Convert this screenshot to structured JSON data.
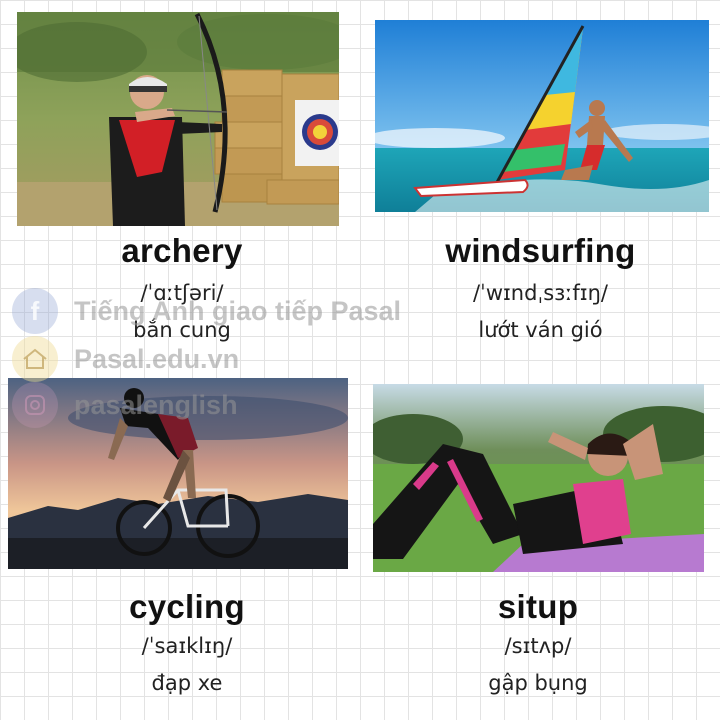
{
  "cards": [
    {
      "word": "archery",
      "ipa": "/ˈɑːtʃəri/",
      "meaning": "bắn cung"
    },
    {
      "word": "windsurfing",
      "ipa": "/ˈwɪndˌsɜːfɪŋ/",
      "meaning": "lướt ván gió"
    },
    {
      "word": "cycling",
      "ipa": "/ˈsaɪklɪŋ/",
      "meaning": "đạp xe"
    },
    {
      "word": "situp",
      "ipa": "/sɪtʌp/",
      "meaning": "gập bụng"
    }
  ],
  "watermark": {
    "line1": "Tiếng Anh giao tiếp Pasal",
    "line2": "Pasal.edu.vn",
    "line3": "pasalenglish"
  }
}
